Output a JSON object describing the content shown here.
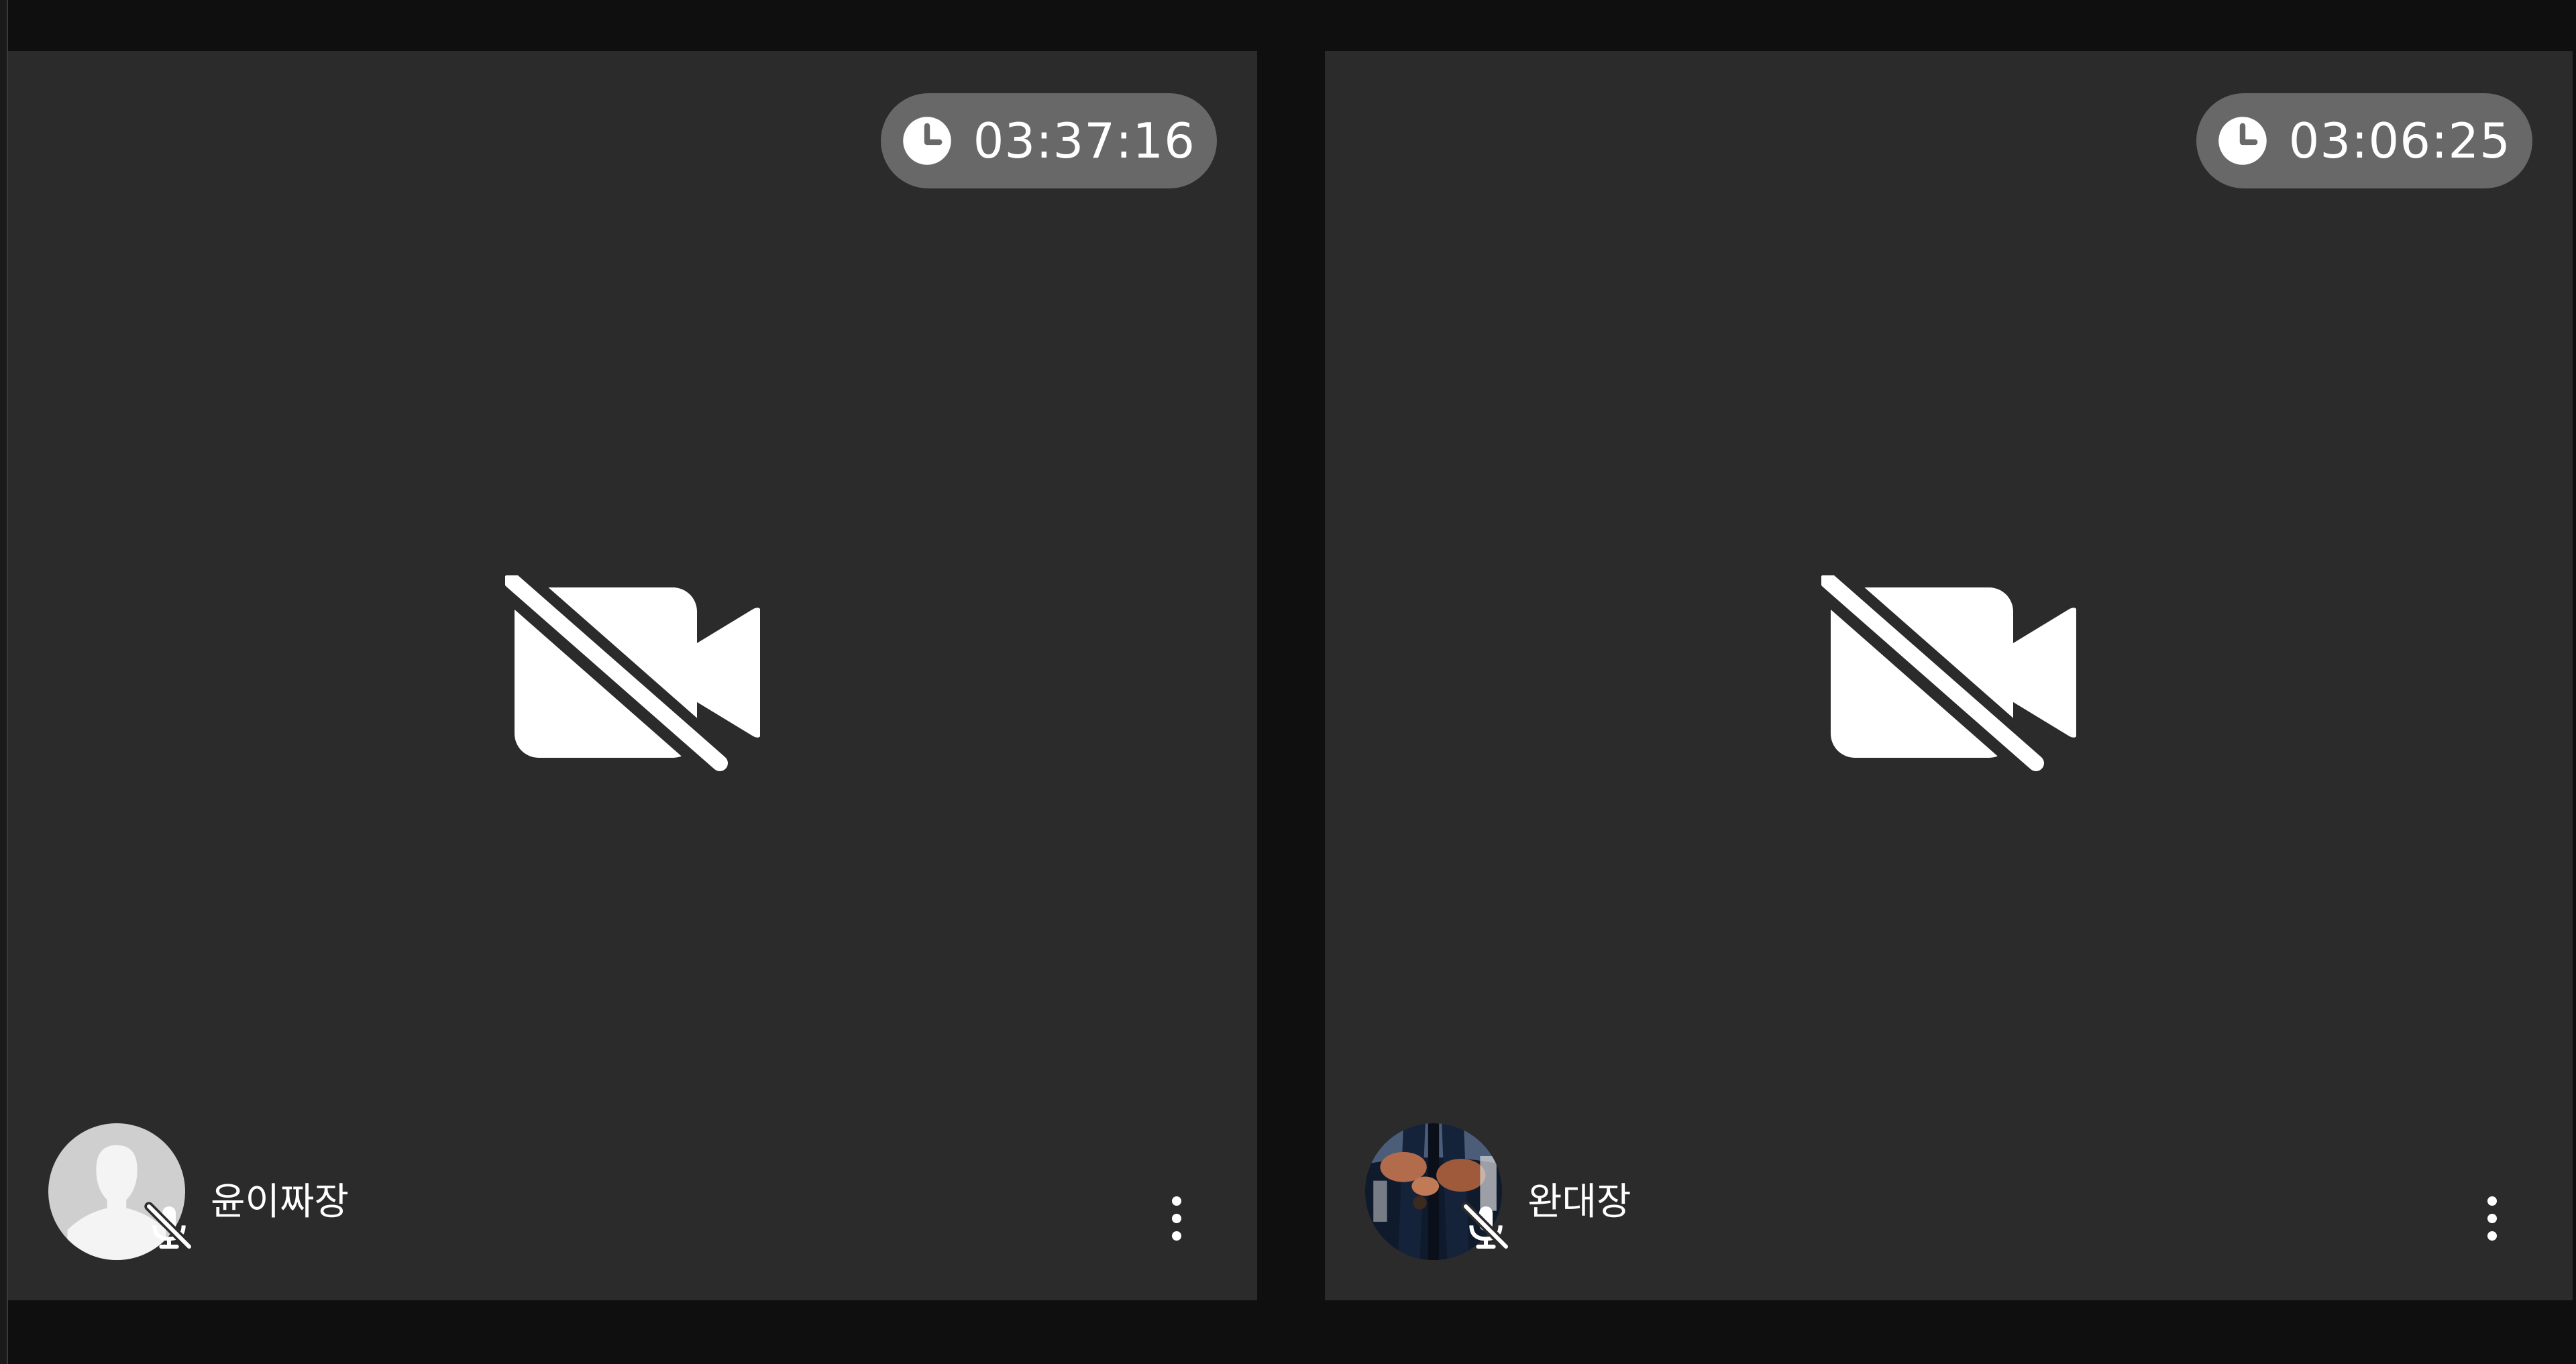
{
  "participants": [
    {
      "name": "윤이짜장",
      "elapsed": "03:37:16",
      "avatar_icon": "default-silhouette-avatar-icon",
      "camera_state_icon": "video-off-icon",
      "mic_state_icon": "mic-off-icon",
      "menu_icon": "more-vertical-icon"
    },
    {
      "name": "완대장",
      "elapsed": "03:06:25",
      "avatar_icon": "profile-photo-avatar",
      "camera_state_icon": "video-off-icon",
      "mic_state_icon": "mic-off-icon",
      "menu_icon": "more-vertical-icon"
    }
  ],
  "colors": {
    "background": "#0f0f0f",
    "tile": "#2b2b2b",
    "timer_pill": "#686868",
    "foreground": "#ffffff"
  }
}
